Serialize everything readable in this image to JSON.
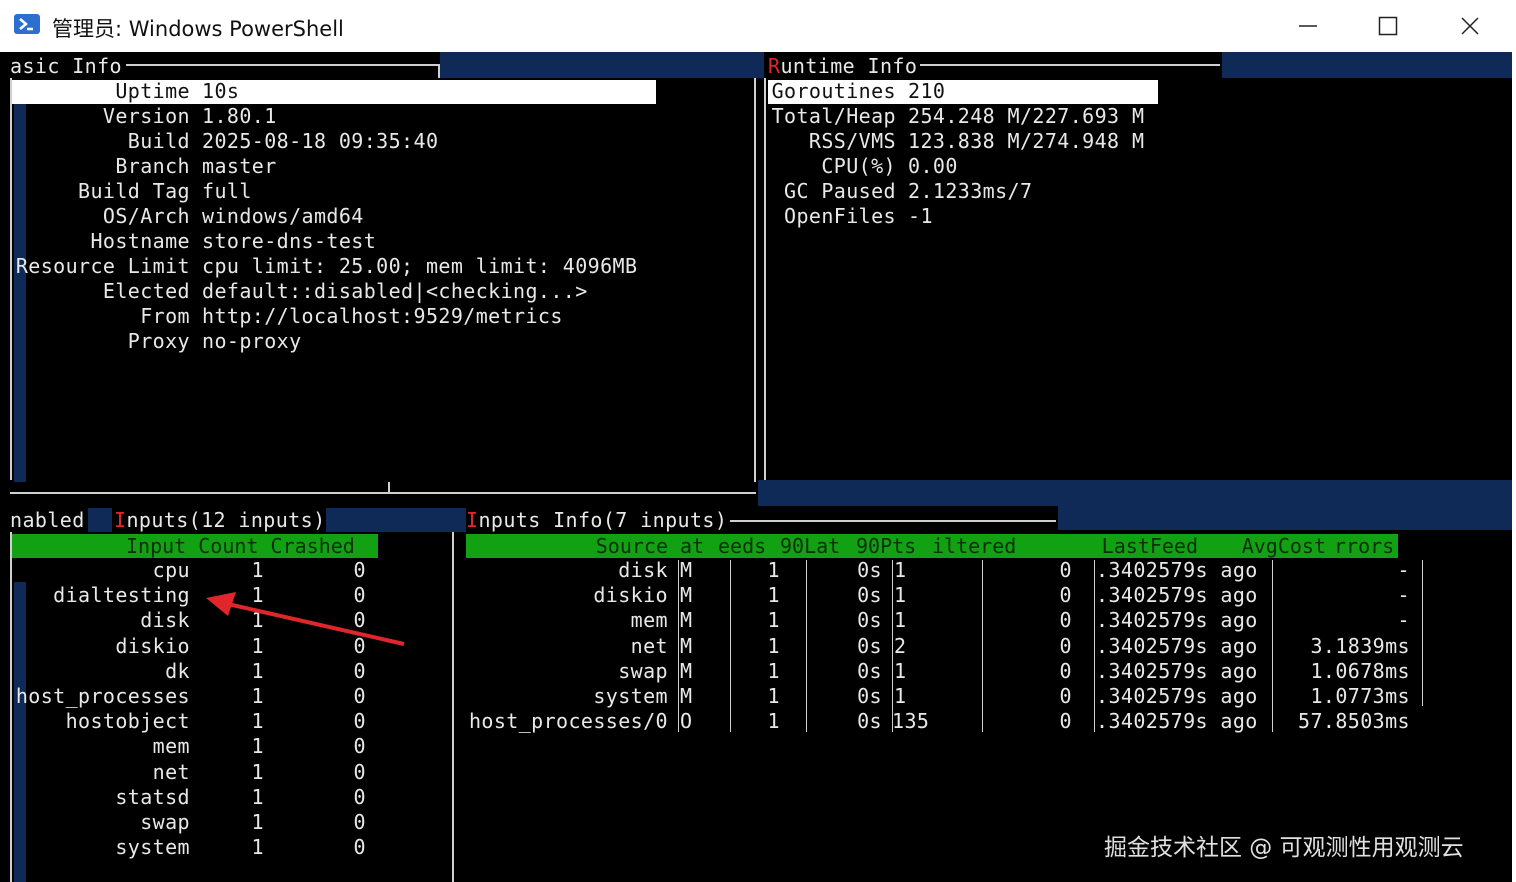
{
  "window": {
    "title": "管理员: Windows PowerShell",
    "icons": {
      "app": "powershell-icon",
      "minimize": "minimize-icon",
      "maximize": "maximize-icon",
      "close": "close-icon"
    }
  },
  "basic_info": {
    "title_visible": "asic Info",
    "rows": [
      {
        "key": "Uptime",
        "value": "10s"
      },
      {
        "key": "Version",
        "value": "1.80.1"
      },
      {
        "key": "Build",
        "value": "2025-08-18 09:35:40"
      },
      {
        "key": "Branch",
        "value": "master"
      },
      {
        "key": "Build Tag",
        "value": "full"
      },
      {
        "key": "OS/Arch",
        "value": "windows/amd64"
      },
      {
        "key": "Hostname",
        "value": "store-dns-test"
      },
      {
        "key": "Resource Limit",
        "value": "cpu limit: 25.00; mem limit: 4096MB"
      },
      {
        "key": "Elected",
        "value": "default::disabled|<checking...>"
      },
      {
        "key": "From",
        "value": "http://localhost:9529/metrics"
      },
      {
        "key": "Proxy",
        "value": "no-proxy"
      }
    ]
  },
  "runtime_info": {
    "title_first": "R",
    "title_rest": "untime Info",
    "rows": [
      {
        "key": "Goroutines",
        "value": "210"
      },
      {
        "key": "Total/Heap",
        "value": "254.248 M/227.693 M"
      },
      {
        "key": "RSS/VMS",
        "value": "123.838 M/274.948 M"
      },
      {
        "key": "CPU(%)",
        "value": "0.00"
      },
      {
        "key": "GC Paused",
        "value": "2.1233ms/7"
      },
      {
        "key": "OpenFiles",
        "value": "-1"
      }
    ]
  },
  "enabled_tab": "nabled",
  "inputs_tab": {
    "first": "I",
    "rest": "nputs(12 inputs)"
  },
  "inputs_table": {
    "headers": [
      "Input",
      "Count",
      "Crashed"
    ],
    "rows": [
      [
        "cpu",
        "1",
        "0"
      ],
      [
        "dialtesting",
        "1",
        "0"
      ],
      [
        "disk",
        "1",
        "0"
      ],
      [
        "diskio",
        "1",
        "0"
      ],
      [
        "dk",
        "1",
        "0"
      ],
      [
        "host_processes",
        "1",
        "0"
      ],
      [
        "hostobject",
        "1",
        "0"
      ],
      [
        "mem",
        "1",
        "0"
      ],
      [
        "net",
        "1",
        "0"
      ],
      [
        "statsd",
        "1",
        "0"
      ],
      [
        "swap",
        "1",
        "0"
      ],
      [
        "system",
        "1",
        "0"
      ]
    ]
  },
  "inputs_info": {
    "title_first": "I",
    "title_rest": "nputs Info(7 inputs)",
    "headers": [
      "Source",
      "at",
      "eeds",
      "90Lat",
      "90Pts",
      "iltered",
      "LastFeed",
      "AvgCost",
      "rrors"
    ],
    "rows": [
      [
        "disk",
        "M",
        "1",
        "0s",
        "1",
        "0",
        ".3402579s ago",
        "-"
      ],
      [
        "diskio",
        "M",
        "1",
        "0s",
        "1",
        "0",
        ".3402579s ago",
        "-"
      ],
      [
        "mem",
        "M",
        "1",
        "0s",
        "1",
        "0",
        ".3402579s ago",
        "-"
      ],
      [
        "net",
        "M",
        "1",
        "0s",
        "2",
        "0",
        ".3402579s ago",
        "3.1839ms"
      ],
      [
        "swap",
        "M",
        "1",
        "0s",
        "1",
        "0",
        ".3402579s ago",
        "1.0678ms"
      ],
      [
        "system",
        "M",
        "1",
        "0s",
        "1",
        "0",
        ".3402579s ago",
        "1.0773ms"
      ],
      [
        "host_processes/0",
        "O",
        "1",
        "0s",
        "135",
        "0",
        ".3402579s ago",
        "57.8503ms"
      ]
    ]
  },
  "watermark": "掘金技术社区 @ 可观测性用观测云",
  "annotation": {
    "color": "#e0262a",
    "icon": "red-arrow-icon"
  }
}
